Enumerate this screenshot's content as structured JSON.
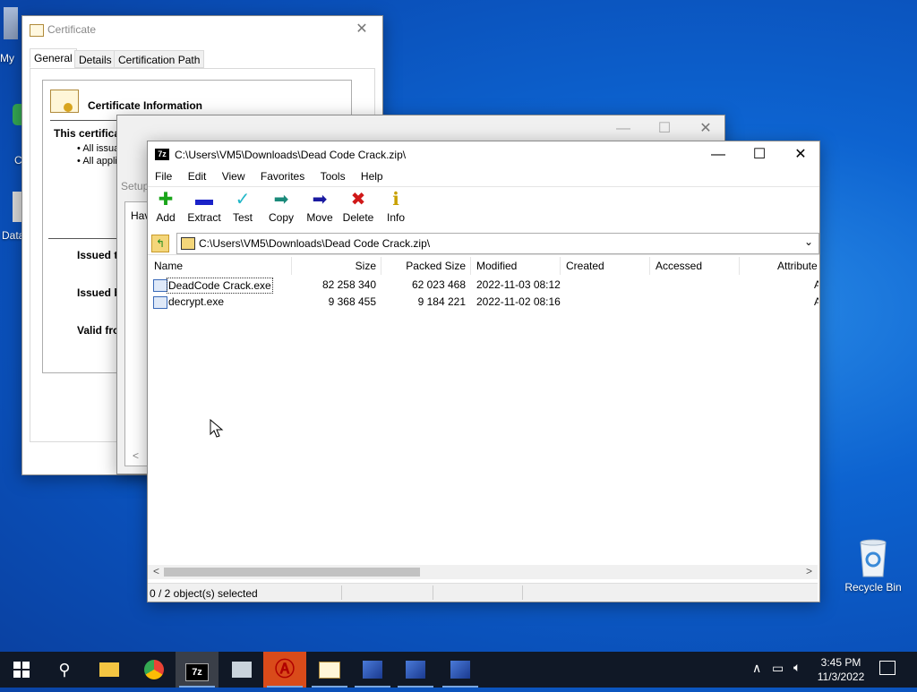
{
  "desktop": {
    "left_texts": [
      "My",
      "C",
      "Data"
    ],
    "recycle_bin_label": "Recycle Bin"
  },
  "certificate": {
    "title": "Certificate",
    "tabs": [
      "General",
      "Details",
      "Certification Path"
    ],
    "header": "Certificate Information",
    "purpose_heading": "This certificate is intended for the following purpose(s):",
    "bullets": [
      "All issuance po",
      "All application p"
    ],
    "issued_to": "Issued t",
    "issued_by": "Issued b",
    "valid_from": "Valid fro"
  },
  "setup_window": {
    "title": "Setup",
    "partial_text": "Hav",
    "scroll_left": "<"
  },
  "sevenzip": {
    "title": "C:\\Users\\VM5\\Downloads\\Dead Code Crack.zip\\",
    "app_icon": "7z",
    "menu": [
      "File",
      "Edit",
      "View",
      "Favorites",
      "Tools",
      "Help"
    ],
    "toolbar": [
      {
        "label": "Add",
        "icon": "plus-icon",
        "color": "#1aa51a",
        "glyph": "✚"
      },
      {
        "label": "Extract",
        "icon": "minus-icon",
        "color": "#1a22c8",
        "glyph": "▬"
      },
      {
        "label": "Test",
        "icon": "check-icon",
        "color": "#22b7c8",
        "glyph": "✓"
      },
      {
        "label": "Copy",
        "icon": "copy-arrow-icon",
        "color": "#1a8a7a",
        "glyph": "➡"
      },
      {
        "label": "Move",
        "icon": "move-arrow-icon",
        "color": "#1a1aa0",
        "glyph": "➡"
      },
      {
        "label": "Delete",
        "icon": "delete-x-icon",
        "color": "#d01818",
        "glyph": "✖"
      },
      {
        "label": "Info",
        "icon": "info-icon",
        "color": "#c8a000",
        "glyph": "ℹ"
      }
    ],
    "address": "C:\\Users\\VM5\\Downloads\\Dead Code Crack.zip\\",
    "columns": [
      "Name",
      "Size",
      "Packed Size",
      "Modified",
      "Created",
      "Accessed",
      "Attribute"
    ],
    "rows": [
      {
        "name": "DeadCode Crack.exe",
        "size": "82 258 340",
        "packed": "62 023 468",
        "modified": "2022-11-03 08:12",
        "attr": "A"
      },
      {
        "name": "decrypt.exe",
        "size": "9 368 455",
        "packed": "9 184 221",
        "modified": "2022-11-02 08:16",
        "attr": "A"
      }
    ],
    "status": "0 / 2 object(s) selected",
    "scroll_left": "<",
    "scroll_right": ">"
  },
  "taskbar": {
    "time": "3:45 PM",
    "date": "11/3/2022",
    "sevenzip_label": "7z"
  }
}
